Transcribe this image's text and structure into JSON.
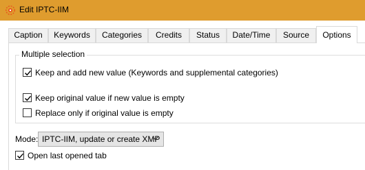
{
  "window": {
    "title": "Edit IPTC-IIM"
  },
  "tabs": [
    {
      "label": "Caption"
    },
    {
      "label": "Keywords"
    },
    {
      "label": "Categories"
    },
    {
      "label": "Credits"
    },
    {
      "label": "Status"
    },
    {
      "label": "Date/Time"
    },
    {
      "label": "Source"
    },
    {
      "label": "Options",
      "active": true
    }
  ],
  "multiple_selection": {
    "title": "Multiple selection",
    "options": [
      {
        "label": "Keep and add new value (Keywords and supplemental categories)",
        "checked": true
      },
      {
        "label": "Keep original value if new value is empty",
        "checked": true
      },
      {
        "label": "Replace only if original value is empty",
        "checked": false
      }
    ]
  },
  "mode": {
    "label": "Mode:",
    "value": "IPTC-IIM, update or create XMP"
  },
  "open_last_tab": {
    "label": "Open last opened tab",
    "checked": true
  },
  "colors": {
    "titlebar": "#df9c2e",
    "icon": "#e8541c"
  }
}
